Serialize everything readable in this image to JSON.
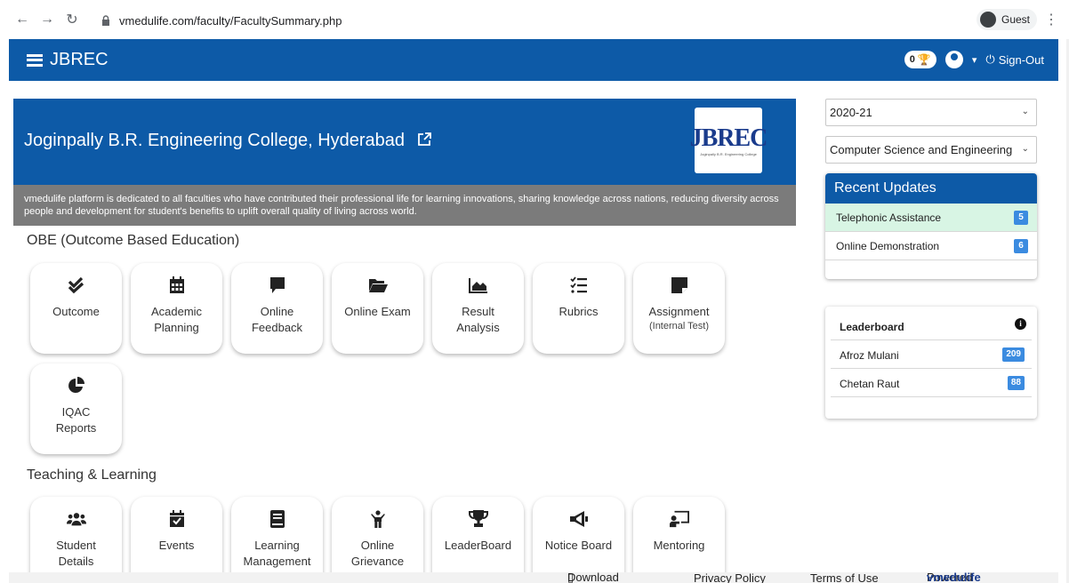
{
  "browser": {
    "url": "vmedulife.com/faculty/FacultySummary.php",
    "profile_label": "Guest",
    "back_icon": "arrow-left-icon",
    "forward_icon": "arrow-right-icon",
    "reload_icon": "reload-icon"
  },
  "header": {
    "title": "JBREC",
    "trophy_count": "0",
    "signout_label": "Sign-Out",
    "accent": "#0d5aa7"
  },
  "banner": {
    "college_name": "Joginpally B.R. Engineering College, Hyderabad",
    "logo_text": "JBREC",
    "logo_tagline": "Joginpally B.R. Engineering College",
    "description": "vmedulife platform is dedicated to all faculties who have contributed their professional life for learning innovations, sharing knowledge across nations, reducing diversity across people and development for student's benefits to uplift overall quality of living across world."
  },
  "obe": {
    "title": "OBE (Outcome Based Education)",
    "tiles": [
      {
        "label": "Outcome",
        "icon": "double-check-icon"
      },
      {
        "label": "Academic\nPlanning",
        "icon": "calendar-icon"
      },
      {
        "label": "Online\nFeedback",
        "icon": "comment-icon"
      },
      {
        "label": "Online Exam",
        "icon": "folder-open-icon"
      },
      {
        "label": "Result\nAnalysis",
        "icon": "area-chart-icon"
      },
      {
        "label": "Rubrics",
        "icon": "checklist-icon"
      },
      {
        "label": "Assignment",
        "sub": "(Internal Test)",
        "icon": "sticky-note-icon"
      },
      {
        "label": "IQAC\nReports",
        "icon": "pie-chart-icon"
      }
    ]
  },
  "teaching": {
    "title": "Teaching & Learning",
    "tiles": [
      {
        "label": "Student\nDetails",
        "icon": "users-icon"
      },
      {
        "label": "Events",
        "icon": "calendar-check-icon"
      },
      {
        "label": "Learning\nManagement",
        "icon": "book-icon"
      },
      {
        "label": "Online\nGrievance",
        "icon": "person-raised-icon"
      },
      {
        "label": "LeaderBoard",
        "icon": "trophy-icon"
      },
      {
        "label": "Notice Board",
        "icon": "megaphone-icon"
      },
      {
        "label": "Mentoring",
        "icon": "chalkboard-teacher-icon"
      }
    ]
  },
  "filters": {
    "year": "2020-21",
    "department": "Computer Science and Engineering"
  },
  "updates": {
    "title": "Recent Updates",
    "items": [
      {
        "label": "Telephonic Assistance",
        "count": "5"
      },
      {
        "label": "Online Demonstration",
        "count": "6"
      }
    ]
  },
  "leaderboard": {
    "title": "Leaderboard",
    "items": [
      {
        "name": "Afroz Mulani",
        "score": "209"
      },
      {
        "name": "Chetan Raut",
        "score": "88"
      }
    ]
  },
  "footer": {
    "download": "Download App",
    "privacy": "Privacy Policy",
    "terms": "Terms of Use",
    "powered_prefix": "Powered by",
    "powered_brand": "vmedulife"
  }
}
